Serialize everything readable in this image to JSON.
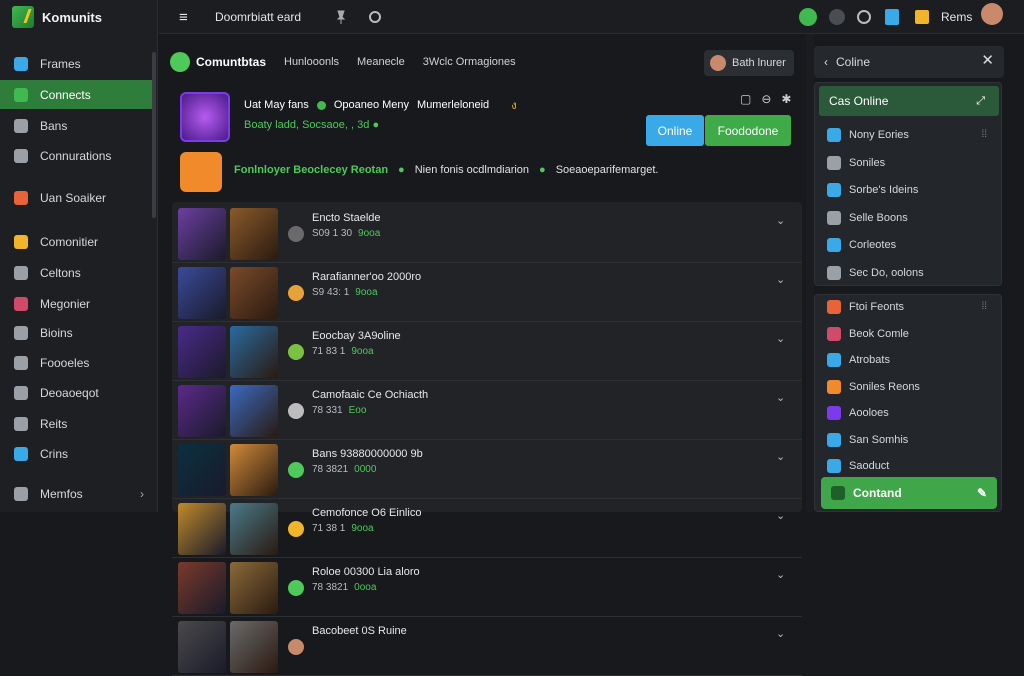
{
  "app": {
    "name": "Komunits"
  },
  "sidebar": {
    "items": [
      {
        "label": "Frames",
        "icon": "frame-icon",
        "color": "#3aa9e8"
      },
      {
        "label": "Connects",
        "icon": "connect-icon",
        "color": "#3fb950",
        "active": true
      },
      {
        "label": "Bans",
        "icon": "ban-icon",
        "color": "#9aa0a6"
      },
      {
        "label": "Connurations",
        "icon": "list-icon",
        "color": "#9aa0a6"
      },
      {
        "label": "Uan Soaiker",
        "icon": "fire-icon",
        "color": "#e8623a"
      },
      {
        "label": "Comonitier",
        "icon": "hex-icon",
        "color": "#f0b52a"
      },
      {
        "label": "Celtons",
        "icon": "leaf-icon",
        "color": "#9aa0a6"
      },
      {
        "label": "Megonier",
        "icon": "controller-icon",
        "color": "#d04a6a"
      },
      {
        "label": "Bioins",
        "icon": "globe-icon",
        "color": "#9aa0a6"
      },
      {
        "label": "Foooeles",
        "icon": "pen-icon",
        "color": "#9aa0a6"
      },
      {
        "label": "Deoaoeqot",
        "icon": "target-icon",
        "color": "#9aa0a6"
      },
      {
        "label": "Reits",
        "icon": "drop-icon",
        "color": "#9aa0a6"
      },
      {
        "label": "Crins",
        "icon": "shuffle-icon",
        "color": "#3aa9e8"
      },
      {
        "label": "Memfos",
        "icon": "settings-icon",
        "color": "#9aa0a6",
        "chevron": "›"
      }
    ]
  },
  "topbar": {
    "menu_glyph": "≡",
    "title": "Doomrbiatt eard",
    "right_label": "Rems"
  },
  "main": {
    "tab_title": "Comuntbtas",
    "tabs": [
      "Hunlooonls",
      "Meanecle",
      "3Wclc Ormagiones"
    ],
    "chip_label": "Bath lnurer",
    "game": {
      "title_a": "Uat May fans",
      "title_b": "Opoaneo Meny",
      "title_c": "Mumerleloneid",
      "badge": "ง",
      "sub": "Boaty ladd, Socsaoe, , 3d",
      "sub_icon": "●"
    },
    "feature": {
      "a": "Fonlnloyer Beoclecey Reotan",
      "b": "Nien fonis ocdlmdiarion",
      "c": "Soeaoeparifemarget."
    },
    "ctrl_icons": [
      "▢",
      "⊖",
      "✱"
    ],
    "btn_online": "Online",
    "btn_feed": "Foododone"
  },
  "rows": [
    {
      "title": "Encto Staelde",
      "sub": "S09 1 30",
      "sub_g": "9ooa",
      "icon_color": "#6a6a6a"
    },
    {
      "title": "Rarafianner'oo 2000ro",
      "sub": "S9 43: 1",
      "sub_g": "9ooa",
      "icon_color": "#e8a23a"
    },
    {
      "title": "Eoocbay 3A9oline",
      "sub": "71 83 1",
      "sub_g": "9ooa",
      "icon_color": "#7cc242"
    },
    {
      "title": "Camofaaic Ce Ochiacth",
      "sub": "78 331",
      "sub_g": "Eoo",
      "icon_color": "#bdbdbd"
    },
    {
      "title": "Bans 93880000000 9b",
      "sub": "78 3821",
      "sub_g": "0000",
      "icon_color": "#4ec95a"
    },
    {
      "title": "Cemofonce O6 Einlico",
      "sub": "71 38 1",
      "sub_g": "9ooa",
      "icon_color": "#f0b52a"
    },
    {
      "title": "Roloe 00300 Lia aloro",
      "sub": "78 3821",
      "sub_g": "0ooa",
      "icon_color": "#4ec95a"
    },
    {
      "title": "Bacobeet 0S Ruine",
      "sub": "",
      "sub_g": "",
      "icon_color": "#c9896b"
    }
  ],
  "right": {
    "head": "Coline",
    "online": "Cas Online",
    "items1": [
      {
        "label": "Nony Eories",
        "color": "#3aa9e8"
      },
      {
        "label": "Soniles",
        "color": "#9aa0a6"
      },
      {
        "label": "Sorbe's Ideins",
        "color": "#3aa9e8"
      },
      {
        "label": "Selle Boons",
        "color": "#9aa0a6"
      },
      {
        "label": "Corleotes",
        "color": "#3aa9e8"
      },
      {
        "label": "Sec Do, oolons",
        "color": "#9aa0a6"
      }
    ],
    "items2": [
      {
        "label": "Ftoi Feonts",
        "color": "#e8623a"
      },
      {
        "label": "Beok Comle",
        "color": "#d04a6a"
      },
      {
        "label": "Atrobats",
        "color": "#3aa9e8"
      },
      {
        "label": "Soniles Reons",
        "color": "#f08a2a"
      },
      {
        "label": "Aooloes",
        "color": "#7c3aed"
      },
      {
        "label": "San Somhis",
        "color": "#3aa9e8"
      },
      {
        "label": "Saoduct",
        "color": "#3aa9e8"
      }
    ],
    "contact": "Contand"
  }
}
